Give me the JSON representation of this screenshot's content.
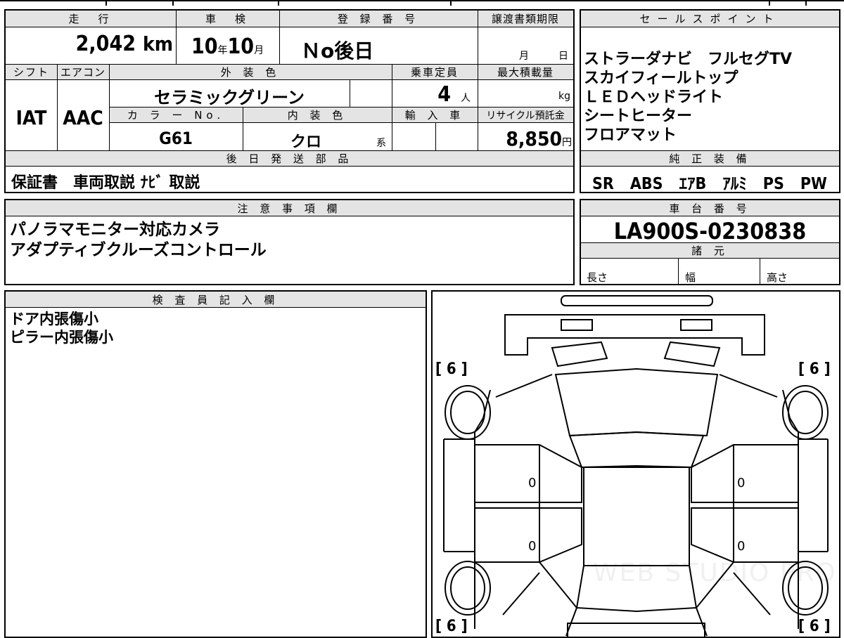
{
  "summary": {
    "mileage_header": "走　行",
    "mileage_value": "2,042",
    "mileage_unit": "km",
    "inspection_header": "車　検",
    "inspection_year": "10",
    "inspection_year_unit": "年",
    "inspection_month": "10",
    "inspection_month_unit": "月",
    "registration_header": "登 録 番 号",
    "registration_value": "Ｎo後日",
    "transfer_header": "譲渡書類期限",
    "transfer_month_unit": "月",
    "transfer_day_unit": "日",
    "shift_header": "シフト",
    "shift_value": "IAT",
    "aircon_header": "エアコン",
    "aircon_value": "AAC",
    "exterior_header": "外 装 色",
    "exterior_value": "セラミックグリーン",
    "capacity_header": "乗車定員",
    "capacity_value": "4",
    "capacity_unit": "人",
    "load_header": "最大積載量",
    "load_unit": "kg",
    "color_no_header": "カ ラ ー No.",
    "color_no_value": "G61",
    "interior_header": "内 装 色",
    "interior_value": "クロ",
    "interior_suffix": "系",
    "import_header": "輸 入 車",
    "recycle_header": "リサイクル預託金",
    "recycle_value": "8,850",
    "recycle_unit": "円",
    "later_parts_header": "後 日 発 送 部 品",
    "later_parts_value": "保証書　車両取説 ﾅﾋﾞ 取説"
  },
  "sales": {
    "header": "セールスポイント",
    "points": [
      "ストラーダナビ　フルセグTV",
      "スカイフィールトップ",
      "ＬＥＤヘッドライト",
      "シートヒーター",
      "フロアマット"
    ]
  },
  "equipment": {
    "header": "純 正 装 備",
    "value": "SR　ABS　ｴｱB　ｱﾙﾐ　PS　PW"
  },
  "notes": {
    "header": "注 意 事 項 欄",
    "lines": [
      "パノラマモニター対応カメラ",
      "アダプティブクルーズコントロール"
    ]
  },
  "chassis": {
    "header": "車 台 番 号",
    "value": "LA900S-0230838",
    "spec_header": "諸 元",
    "length_label": "長さ",
    "width_label": "幅",
    "height_label": "高さ"
  },
  "inspector": {
    "header": "検 査 員 記 入 欄",
    "lines": [
      "ドア内張傷小",
      "ピラー内張傷小"
    ]
  },
  "diagram": {
    "tire_fl": "[ 6 ]",
    "tire_fr": "[ 6 ]",
    "tire_rl": "[ 6 ]",
    "tire_rr": "[ 6 ]",
    "door_fl": "0",
    "door_fr": "0",
    "door_rl": "0",
    "door_rr": "0",
    "watermark": "WEB STUDIO PRO"
  }
}
